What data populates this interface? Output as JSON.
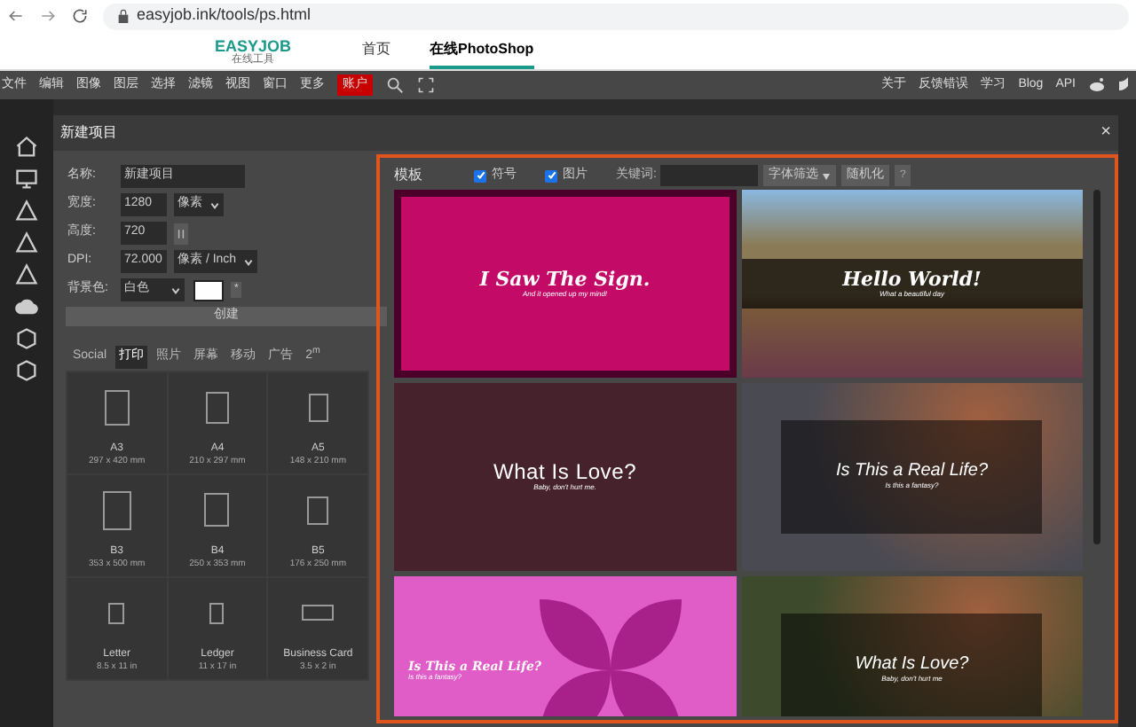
{
  "browser": {
    "url": "easyjob.ink/tools/ps.html"
  },
  "site": {
    "logo": "EASYJOB",
    "logo_sub": "在线工具",
    "nav": [
      {
        "label": "首页",
        "selected": false
      },
      {
        "label": "在线PhotoShop",
        "selected": true
      }
    ]
  },
  "menu": {
    "items": [
      {
        "label": "文件",
        "kind": "text"
      },
      {
        "label": "编辑",
        "kind": "text"
      },
      {
        "label": "图像",
        "kind": "text"
      },
      {
        "label": "图层",
        "kind": "text"
      },
      {
        "label": "选择",
        "kind": "text"
      },
      {
        "label": "滤镜",
        "kind": "text"
      },
      {
        "label": "视图",
        "kind": "text"
      },
      {
        "label": "窗口",
        "kind": "text"
      },
      {
        "label": "更多",
        "kind": "text"
      },
      {
        "label": "账户",
        "kind": "highlight"
      }
    ],
    "right_items": [
      "关于",
      "反馈错误",
      "学习",
      "Blog",
      "API"
    ]
  },
  "dialog": {
    "title": "新建项目",
    "close": "×",
    "fields": [
      {
        "label": "名称:",
        "kind": "text",
        "value": "新建项目"
      },
      {
        "label": "宽度:",
        "kind": "unit",
        "value": "1280",
        "unit": "像素"
      },
      {
        "label": "高度:",
        "kind": "swap",
        "value": "720"
      },
      {
        "label": "DPI:",
        "kind": "unit",
        "value": "72.000",
        "unit": "像素 / Inch"
      },
      {
        "label": "背景色:",
        "kind": "color",
        "value": "白色",
        "color": "#ffffff",
        "extra": "*"
      }
    ],
    "create": "创建",
    "preset_tabs": [
      {
        "label": "Social",
        "selected": false
      },
      {
        "label": "打印",
        "selected": true
      },
      {
        "label": "照片",
        "selected": false
      },
      {
        "label": "屏幕",
        "selected": false
      },
      {
        "label": "移动",
        "selected": false
      },
      {
        "label": "广告",
        "selected": false
      },
      {
        "label": "2$^{m}$",
        "selected": false
      }
    ],
    "presets": [
      {
        "name": "A3",
        "size": "297 x 420 mm"
      },
      {
        "name": "A4",
        "size": "210 x 297 mm"
      },
      {
        "name": "A5",
        "size": "148 x 210 mm"
      },
      {
        "name": "B3",
        "size": "353 x 500 mm"
      },
      {
        "name": "B4",
        "size": "250 x 353 mm"
      },
      {
        "name": "B5",
        "size": "176 x 250 mm"
      },
      {
        "name": "Letter",
        "size": "8.5 x 11 in"
      },
      {
        "name": "Ledger",
        "size": "11 x 17 in"
      },
      {
        "name": "Business Card",
        "size": "3.5 x 2 in"
      }
    ],
    "templates": {
      "title": "模板",
      "filters": [
        {
          "label": "符号",
          "checked": true
        },
        {
          "label": "图片",
          "checked": true
        }
      ],
      "keyword_label": "关键词:",
      "font_filter": "字体筛选",
      "randomize": "随机化",
      "help": "?",
      "tiles": [
        {
          "kind": "framed",
          "title": "I Saw The Sign.",
          "subtitle": "And it opened up my mind!",
          "color": "#c20a66"
        },
        {
          "kind": "band",
          "title": "Hello World!",
          "subtitle": "What a beautiful day",
          "color": "#8a7a55"
        },
        {
          "kind": "solid",
          "title": "What Is Love?",
          "subtitle": "Baby, don't hurt me.",
          "color": "#45222c"
        },
        {
          "kind": "boxed",
          "title": "Is This a Real Life?",
          "subtitle": "Is this a fantasy?",
          "color": "#4a4a52"
        },
        {
          "kind": "flower",
          "title": "Is This a Real Life?",
          "subtitle": "Is this a fantasy?",
          "color": "#e05cc6"
        },
        {
          "kind": "boxed",
          "title": "What Is Love?",
          "subtitle": "Baby, don't hurt me",
          "color": "#3d4a2c"
        }
      ]
    }
  }
}
